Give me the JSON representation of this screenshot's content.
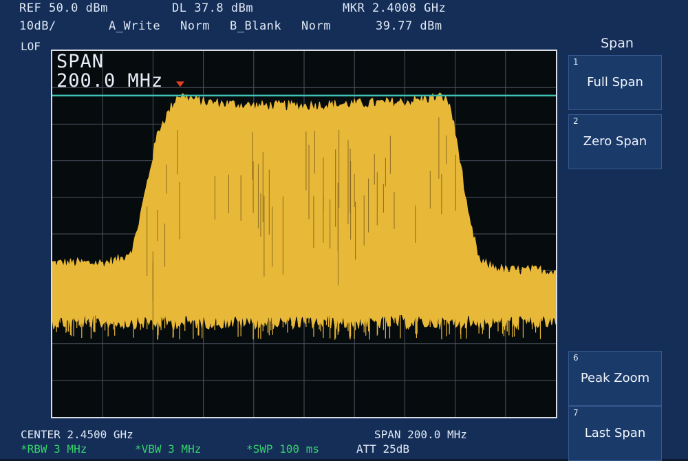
{
  "header": {
    "ref_level": "REF 50.0 dBm",
    "scale": "10dB/",
    "display_line": "DL 37.8 dBm",
    "trace_a": "A_Write",
    "trace_a_mode": "Norm",
    "trace_b": "B_Blank",
    "trace_b_mode": "Norm",
    "marker_freq": "MKR 2.4008 GHz",
    "marker_level": "39.77 dBm",
    "lof": "LOF"
  },
  "span_overlay": {
    "label": "SPAN",
    "value": "200.0 MHz"
  },
  "footer": {
    "center": "CENTER 2.4500 GHz",
    "span": "SPAN 200.0 MHz",
    "rbw": "*RBW 3 MHz",
    "vbw": "*VBW 3 MHz",
    "sweep": "*SWP 100 ms",
    "att": "ATT 25dB"
  },
  "softkeys": {
    "title": "Span",
    "keys": [
      {
        "num": "1",
        "label": "Full Span"
      },
      {
        "num": "2",
        "label": "Zero Span"
      },
      {
        "num": "6",
        "label": "Peak Zoom"
      },
      {
        "num": "7",
        "label": "Last Span"
      }
    ]
  },
  "colors": {
    "trace": "#e8b838",
    "display_line": "#3fc4b4",
    "marker": "#e0402a",
    "grid": "#4d5560",
    "background": "#060b0e"
  },
  "chart_data": {
    "type": "line",
    "title": "",
    "xlabel": "",
    "ylabel": "",
    "x_range_ghz": [
      2.35,
      2.55
    ],
    "ylim_dbm": [
      -50,
      50
    ],
    "grid": true,
    "display_line_dbm": 37.8,
    "marker": {
      "x_ghz": 2.4008,
      "y_dbm": 39.77
    },
    "series": [
      {
        "envelope_upper": {
          "x_ghz": [
            2.35,
            2.37,
            2.377,
            2.382,
            2.385,
            2.392,
            2.4,
            2.41,
            2.43,
            2.45,
            2.47,
            2.49,
            2.5,
            2.505,
            2.508,
            2.512,
            2.515,
            2.52,
            2.53,
            2.55
          ],
          "y_dbm": [
            -8,
            -8,
            -7,
            -4,
            5,
            28,
            38,
            36,
            35,
            35,
            35.5,
            36,
            37,
            37.5,
            35,
            20,
            5,
            -8,
            -10,
            -10
          ]
        },
        "envelope_lower": {
          "x_ghz": [
            2.35,
            2.55
          ],
          "y_dbm": [
            -22,
            -22
          ]
        }
      }
    ]
  }
}
